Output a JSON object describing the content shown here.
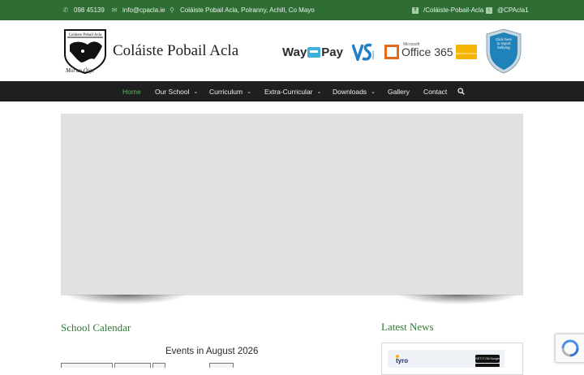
{
  "topbar": {
    "phone": "098 45139",
    "email": "info@cpacla.ie",
    "address": "Coláiste Pobail Acla, Polranny, Achill, Co Mayo",
    "facebook": "/Coláiste-Pobail-Acla",
    "twitter": "@CPAcla1"
  },
  "header": {
    "school_name": "Coláiste Pobail Acla",
    "crest_text": "Coláiste Pobail Acla",
    "motto": "Mol an Óige"
  },
  "partners": {
    "waypay_way": "Way",
    "waypay_pay": "Pay",
    "vsware": "VSware",
    "office_ms": "Microsoft",
    "office": "Office 365",
    "bully_line1": "Click here",
    "bully_line2": "to report",
    "bully_line3": "bullying"
  },
  "nav": {
    "home": "Home",
    "our_school": "Our School",
    "curriculum": "Curriculum",
    "extra_curricular": "Extra-Curricular",
    "downloads": "Downloads",
    "gallery": "Gallery",
    "contact": "Contact"
  },
  "calendar": {
    "title": "School Calendar",
    "events_heading": "Events in August 2026"
  },
  "news": {
    "title": "Latest News",
    "tyro_logo": "tyro",
    "gplay_label": "GET IT ON Google Play"
  },
  "colors": {
    "brand_green": "#2e6e34",
    "heading_green": "#2f7a37",
    "nav_active": "#5cb85c",
    "nav_bg": "#1f1f1f"
  }
}
